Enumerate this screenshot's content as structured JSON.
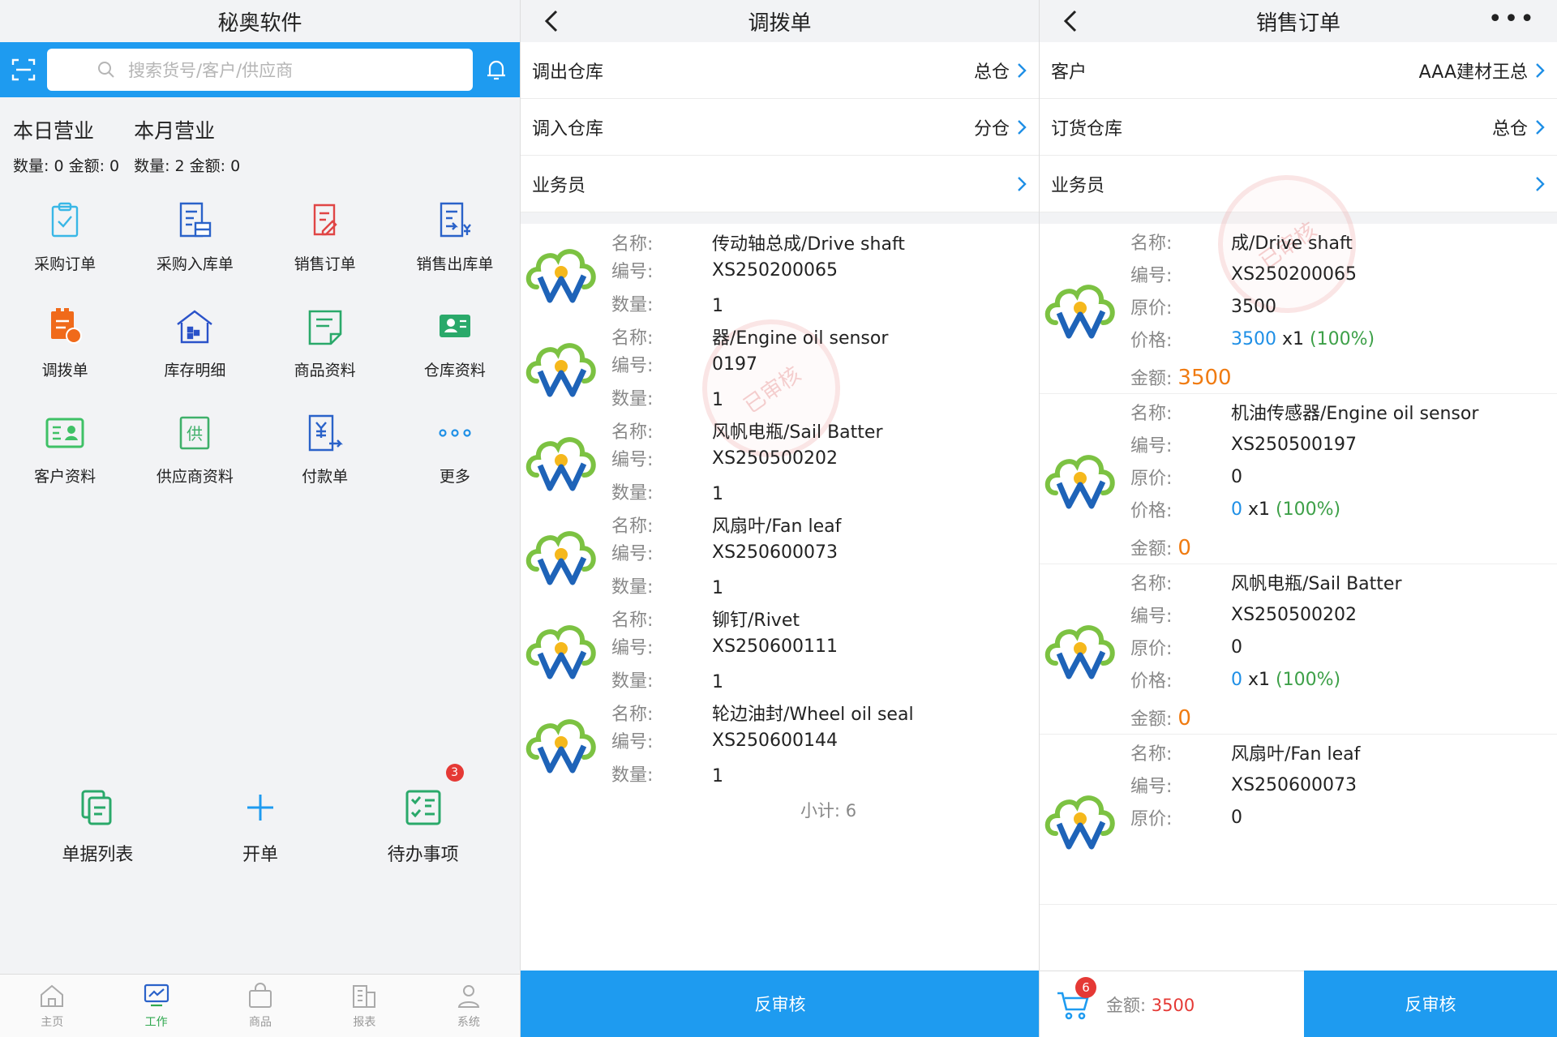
{
  "left_panel": {
    "title": "秘奥软件",
    "search_placeholder": "搜索货号/客户/供应商",
    "today": {
      "title": "本日营业",
      "summary": "数量: 0  金额: 0"
    },
    "month": {
      "title": "本月营业",
      "summary": "数量: 2  金额: 0"
    },
    "grid": [
      {
        "label": "采购订单",
        "icon": "clipboard-check-icon",
        "color": "#39b7e6"
      },
      {
        "label": "采购入库单",
        "icon": "doc-inbox-icon",
        "color": "#2a62c9"
      },
      {
        "label": "销售订单",
        "icon": "doc-edit-icon",
        "color": "#e04545"
      },
      {
        "label": "销售出库单",
        "icon": "doc-yen-icon",
        "color": "#2a62c9"
      },
      {
        "label": "调拨单",
        "icon": "transfer-doc-icon",
        "color": "#f06a1a"
      },
      {
        "label": "库存明细",
        "icon": "warehouse-icon",
        "color": "#2a52c9"
      },
      {
        "label": "商品资料",
        "icon": "goods-doc-icon",
        "color": "#2aa96a"
      },
      {
        "label": "仓库资料",
        "icon": "store-person-icon",
        "color": "#2aa96a"
      },
      {
        "label": "客户资料",
        "icon": "customer-card-icon",
        "color": "#3fc166"
      },
      {
        "label": "供应商资料",
        "icon": "supplier-icon",
        "color": "#3fb06a"
      },
      {
        "label": "付款单",
        "icon": "payment-doc-icon",
        "color": "#2a62c9"
      },
      {
        "label": "更多",
        "icon": "more-dots-icon",
        "color": "#1e8fe6"
      }
    ],
    "quick": [
      {
        "label": "单据列表",
        "icon": "doc-list-icon"
      },
      {
        "label": "开单",
        "icon": "plus-icon"
      },
      {
        "label": "待办事项",
        "icon": "todo-list-icon",
        "badge": "3"
      }
    ],
    "tabs": [
      {
        "label": "主页",
        "icon": "home-icon"
      },
      {
        "label": "工作",
        "icon": "work-monitor-icon"
      },
      {
        "label": "商品",
        "icon": "shopping-bag-icon"
      },
      {
        "label": "报表",
        "icon": "report-icon"
      },
      {
        "label": "系统",
        "icon": "user-icon"
      }
    ]
  },
  "mid_panel": {
    "title": "调拨单",
    "rows": [
      {
        "label": "调出仓库",
        "value": "总仓"
      },
      {
        "label": "调入仓库",
        "value": "分仓"
      },
      {
        "label": "业务员",
        "value": ""
      }
    ],
    "field_labels": {
      "name": "名称:",
      "code": "编号:",
      "qty": "数量:"
    },
    "items": [
      {
        "name": "传动轴总成/Drive shaft",
        "code": "XS250200065",
        "qty": "1"
      },
      {
        "name": "器/Engine oil sensor",
        "code": "0197",
        "qty": "1"
      },
      {
        "name": "风帆电瓶/Sail Batter",
        "code": "XS250500202",
        "qty": "1"
      },
      {
        "name": "风扇叶/Fan leaf",
        "code": "XS250600073",
        "qty": "1"
      },
      {
        "name": "铆钉/Rivet",
        "code": "XS250600111",
        "qty": "1"
      },
      {
        "name": "轮边油封/Wheel oil seal",
        "code": "XS250600144",
        "qty": "1"
      }
    ],
    "subtotal": "小计: 6",
    "stamp": "已审核",
    "button": "反审核"
  },
  "right_panel": {
    "title": "销售订单",
    "more": "•••",
    "rows": [
      {
        "label": "客户",
        "value": "AAA建材王总"
      },
      {
        "label": "订货仓库",
        "value": "总仓"
      },
      {
        "label": "业务员",
        "value": ""
      }
    ],
    "field_labels": {
      "name": "名称:",
      "code": "编号:",
      "orig": "原价:",
      "price": "价格:",
      "amount": "金额:"
    },
    "items": [
      {
        "name": "成/Drive shaft",
        "code": "XS250200065",
        "orig": "3500",
        "price": "3500",
        "mult": "x1",
        "pct": "(100%)",
        "amount": "3500"
      },
      {
        "name": "机油传感器/Engine oil sensor",
        "code": "XS250500197",
        "orig": "0",
        "price": "0",
        "mult": "x1",
        "pct": "(100%)",
        "amount": "0"
      },
      {
        "name": "风帆电瓶/Sail Batter",
        "code": "XS250500202",
        "orig": "0",
        "price": "0",
        "mult": "x1",
        "pct": "(100%)",
        "amount": "0"
      },
      {
        "name": "风扇叶/Fan leaf",
        "code": "XS250600073",
        "orig": "0",
        "price": "",
        "mult": "",
        "pct": "",
        "amount": ""
      }
    ],
    "stamp": "已审核",
    "cart_badge": "6",
    "cart_label": "金额:",
    "cart_amount": "3500",
    "button": "反审核"
  }
}
